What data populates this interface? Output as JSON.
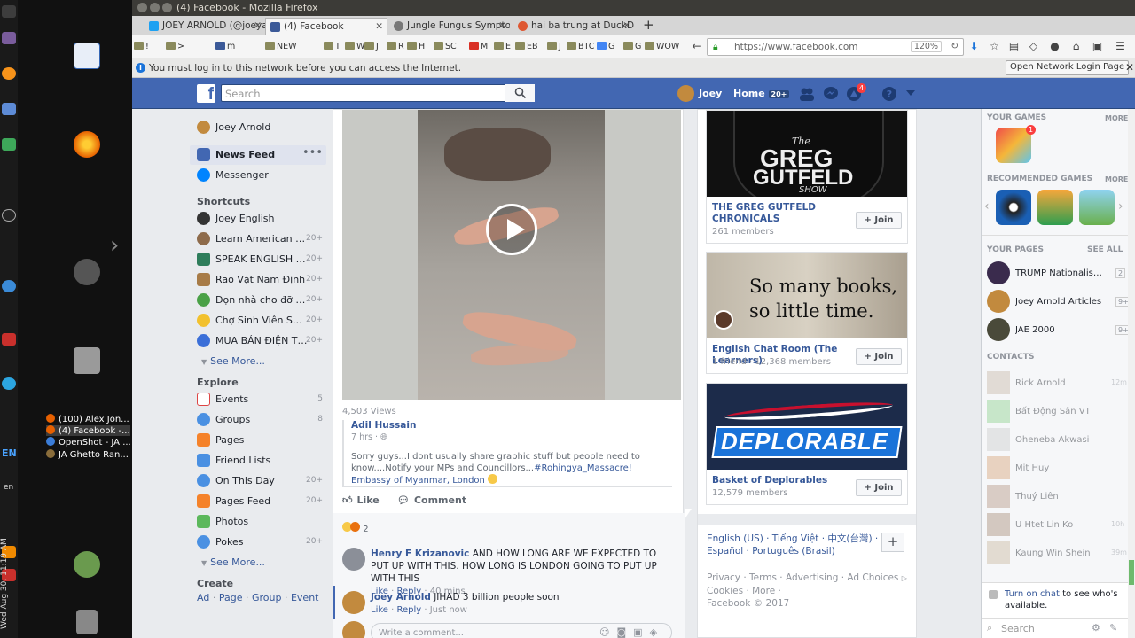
{
  "window_title": "(4) Facebook - Mozilla Firefox",
  "tabs": [
    {
      "label": "JOEY ARNOLD (@joeyarnold)",
      "active": false
    },
    {
      "label": "(4) Facebook",
      "active": true
    },
    {
      "label": "Jungle Fungus Symptoms",
      "active": false
    },
    {
      "label": "hai ba trung at DuckDuckGo",
      "active": false
    }
  ],
  "bookmarks": [
    "!",
    ">",
    "m",
    "NEW",
    "T",
    "W",
    "J",
    "R",
    "H",
    "SC",
    "M",
    "E",
    "EB",
    "J",
    "BTC",
    "G",
    "G",
    "WOW"
  ],
  "url": "https://www.facebook.com",
  "zoom": "120%",
  "notice": {
    "message": "You must log in to this network before you can access the Internet.",
    "button": "Open Network Login Page"
  },
  "taskbar": [
    {
      "label": "(100) Alex Jon...",
      "color": "#e66000"
    },
    {
      "label": "(4) Facebook -...",
      "color": "#e66000"
    },
    {
      "label": "OpenShot - JA ...",
      "color": "#3b7dd8"
    },
    {
      "label": "JA Ghetto Ran...",
      "color": "#8a6d3b"
    }
  ],
  "clock": "Wed Aug 30, 11:19 AM",
  "dock_lang": "EN",
  "dock_lang2": "en",
  "fb_header": {
    "search_placeholder": "Search",
    "user": "Joey",
    "home": "Home",
    "home_count": "20+",
    "notif_count": "4"
  },
  "left_nav": {
    "profile": "Joey Arnold",
    "news_feed": "News Feed",
    "messenger": "Messenger",
    "shortcuts_title": "Shortcuts",
    "shortcuts": [
      {
        "label": "Joey English",
        "count": ""
      },
      {
        "label": "Learn American En...",
        "count": "20+"
      },
      {
        "label": "SPEAK ENGLISH F...",
        "count": "20+"
      },
      {
        "label": "Rao Vặt Nam Định",
        "count": "20+"
      },
      {
        "label": "Dọn nhà cho đỡ chật",
        "count": "20+"
      },
      {
        "label": "Chợ Sinh Viên Sư ...",
        "count": "20+"
      },
      {
        "label": "MUA BÁN ĐIỆN TH...",
        "count": "20+"
      }
    ],
    "see_more": "See More...",
    "explore_title": "Explore",
    "explore": [
      {
        "label": "Events",
        "count": "5"
      },
      {
        "label": "Groups",
        "count": "8"
      },
      {
        "label": "Pages",
        "count": ""
      },
      {
        "label": "Friend Lists",
        "count": ""
      },
      {
        "label": "On This Day",
        "count": "20+"
      },
      {
        "label": "Pages Feed",
        "count": "20+"
      },
      {
        "label": "Photos",
        "count": ""
      },
      {
        "label": "Pokes",
        "count": "20+"
      }
    ],
    "see_more2": "See More...",
    "create_title": "Create",
    "create_links": [
      "Ad",
      "Page",
      "Group",
      "Event"
    ]
  },
  "post": {
    "views": "4,503 Views",
    "author": "Adil Hussain",
    "time": "7 hrs",
    "text": "Sorry guys...I dont usually share graphic stuff but people need to know....Notify your MPs and Councillors...",
    "hashtag": "#Rohingya_Massacre! Embassy of Myanmar, London",
    "like": "Like",
    "comment": "Comment",
    "reaction_count": "2",
    "comments": [
      {
        "author": "Henry F Krizanovic",
        "text": "AND HOW LONG ARE WE EXPECTED TO PUT UP WITH THIS. HOW LONG IS LONDON GOING TO PUT UP WITH THIS",
        "like": "Like",
        "reply": "Reply",
        "time": "40 mins"
      },
      {
        "author": "Joey Arnold",
        "text": "JIHAD 3 billion people soon",
        "like": "Like",
        "reply": "Reply",
        "time": "Just now"
      }
    ],
    "write_placeholder": "Write a comment..."
  },
  "groups": [
    {
      "name": "THE GREG GUTFELD CHRONICALS",
      "members": "261 members",
      "join": "Join",
      "image_text": [
        "The",
        "GREG",
        "GUTFELD",
        "SHOW"
      ]
    },
    {
      "name": "English Chat Room (The Learners)",
      "members": "1 friend · 12,368 members",
      "join": "Join",
      "image_text": [
        "So many books,",
        "so little time."
      ]
    },
    {
      "name": "Basket of Deplorables",
      "members": "12,579 members",
      "join": "Join",
      "image_text": [
        "DEPLORABLE"
      ]
    }
  ],
  "languages": {
    "line1": "English (US) · Tiếng Việt · 中文(台灣) ·",
    "line2": "Español · Português (Brasil)"
  },
  "footer": {
    "line1": "Privacy · Terms · Advertising · Ad Choices",
    "line2": "Cookies · More ·",
    "line3": "Facebook © 2017"
  },
  "chat_sidebar": {
    "your_games": "YOUR GAMES",
    "more": "MORE",
    "recommended": "RECOMMENDED GAMES",
    "more2": "MORE",
    "your_pages": "YOUR PAGES",
    "see_all": "SEE ALL",
    "pages": [
      {
        "name": "TRUMP Nationalism O...",
        "count": "2"
      },
      {
        "name": "Joey Arnold Articles",
        "count": "9+"
      },
      {
        "name": "JAE 2000",
        "count": "9+"
      }
    ],
    "contacts_title": "CONTACTS",
    "contacts": [
      {
        "name": "Rick Arnold",
        "time": "12m"
      },
      {
        "name": "Bất Động Sản VT",
        "time": ""
      },
      {
        "name": "Oheneba Akwasi",
        "time": ""
      },
      {
        "name": "Mit Huy",
        "time": ""
      },
      {
        "name": "Thuý Liên",
        "time": ""
      },
      {
        "name": "U Htet Lin Ko",
        "time": "10h"
      },
      {
        "name": "Kaung Win Shein",
        "time": "39m"
      }
    ],
    "chat_note_link": "Turn on chat",
    "chat_note": " to see who's available.",
    "search_placeholder": "Search"
  }
}
